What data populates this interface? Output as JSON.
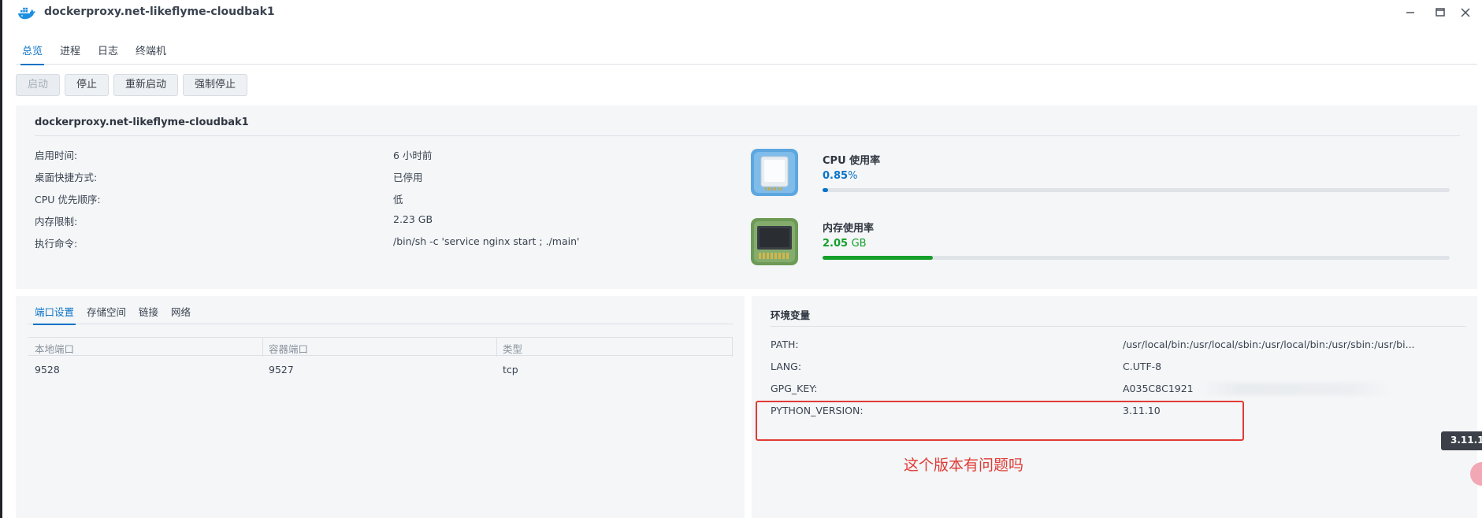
{
  "window": {
    "title": "dockerproxy.net-likeflyme-cloudbak1",
    "icons": [
      "docker-logo-icon",
      "minimize-icon",
      "maximize-icon",
      "close-icon"
    ]
  },
  "tabs": [
    {
      "label": "总览",
      "active": true
    },
    {
      "label": "进程",
      "active": false
    },
    {
      "label": "日志",
      "active": false
    },
    {
      "label": "终端机",
      "active": false
    }
  ],
  "actions": {
    "start": "启动",
    "stop": "停止",
    "restart": "重新启动",
    "force_stop": "强制停止"
  },
  "info": {
    "name": "dockerproxy.net-likeflyme-cloudbak1",
    "rows": [
      {
        "label": "启用时间:",
        "value": "6 小时前"
      },
      {
        "label": "桌面快捷方式:",
        "value": "已停用"
      },
      {
        "label": "CPU 优先顺序:",
        "value": "低"
      },
      {
        "label": "内存限制:",
        "value": "2.23 GB"
      },
      {
        "label": "执行命令:",
        "value": "/bin/sh -c 'service nginx start ; ./main'"
      }
    ]
  },
  "resources": {
    "cpu": {
      "name": "CPU 使用率",
      "value": "0.85",
      "unit": "%",
      "fraction": 0.0085,
      "color": "#0b73c6",
      "icon": "cpu-chip-icon"
    },
    "memory": {
      "name": "内存使用率",
      "value": "2.05",
      "unit": "GB",
      "fraction": 0.176,
      "color": "#14a02b",
      "icon": "memory-module-icon"
    }
  },
  "port_tabs": [
    {
      "label": "端口设置",
      "active": true
    },
    {
      "label": "存储空间",
      "active": false
    },
    {
      "label": "链接",
      "active": false
    },
    {
      "label": "网络",
      "active": false
    }
  ],
  "port_table": {
    "columns": [
      "本地端口",
      "容器端口",
      "类型"
    ],
    "rows": [
      [
        "9528",
        "9527",
        "tcp"
      ]
    ]
  },
  "env": {
    "title": "环境变量",
    "rows": [
      {
        "key": "PATH:",
        "value": "/usr/local/bin:/usr/local/sbin:/usr/local/bin:/usr/sbin:/usr/bi..."
      },
      {
        "key": "LANG:",
        "value": "C.UTF-8"
      },
      {
        "key": "GPG_KEY:",
        "value": "A035C8C1921"
      },
      {
        "key": "PYTHON_VERSION:",
        "value": "3.11.10"
      }
    ]
  },
  "annotation": {
    "text": "这个版本有问题吗",
    "color": "#e03b35"
  },
  "tooltip": {
    "text": "3.11.1"
  }
}
